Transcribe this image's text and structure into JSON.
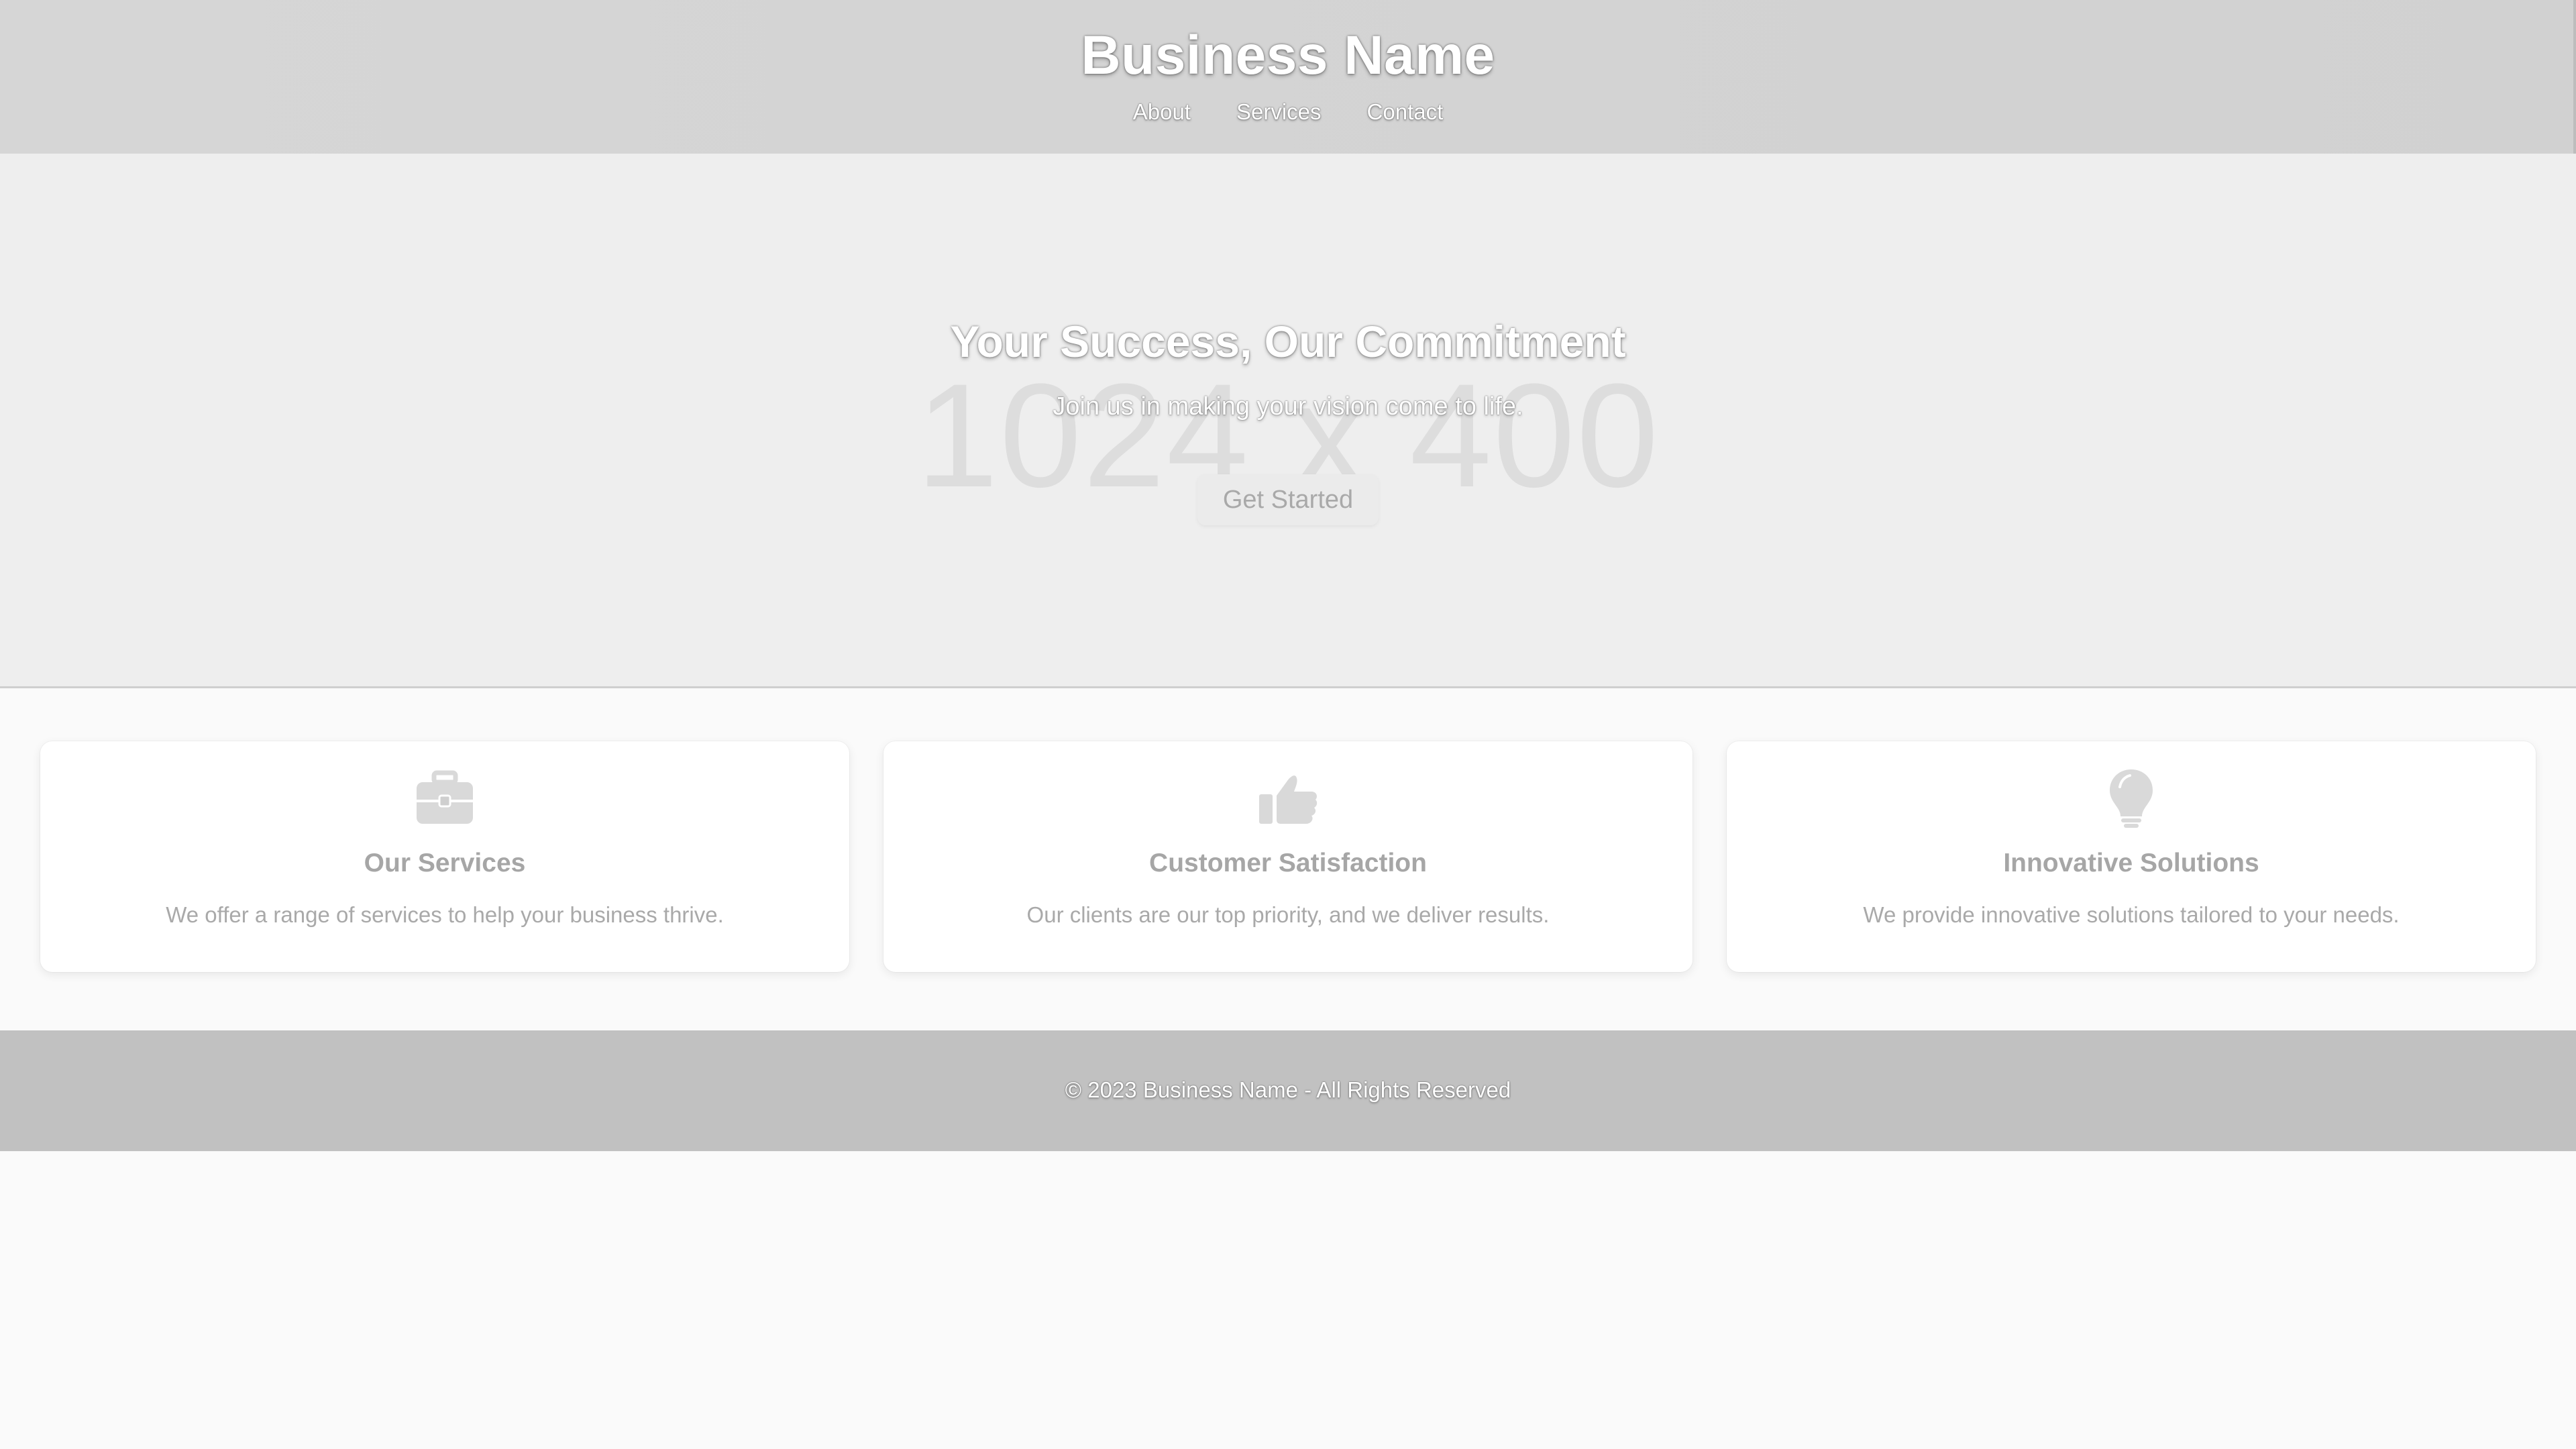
{
  "header": {
    "brand": "Business Name",
    "nav": [
      "About",
      "Services",
      "Contact"
    ]
  },
  "hero": {
    "placeholder": "1024 x 400",
    "title": "Your Success, Our Commitment",
    "subtitle": "Join us in making your vision come to life.",
    "cta_label": "Get Started"
  },
  "features": [
    {
      "icon": "briefcase-icon",
      "title": "Our Services",
      "text": "We offer a range of services to help your business thrive."
    },
    {
      "icon": "thumbs-up-icon",
      "title": "Customer Satisfaction",
      "text": "Our clients are our top priority, and we deliver results."
    },
    {
      "icon": "lightbulb-icon",
      "title": "Innovative Solutions",
      "text": "We provide innovative solutions tailored to your needs."
    }
  ],
  "footer": {
    "text": "© 2023 Business Name - All Rights Reserved"
  },
  "colors": {
    "header_bg": "#d3d3d3",
    "hero_bg": "#eeeeee",
    "footer_bg": "#c1c1c1",
    "card_bg": "#ffffff"
  }
}
